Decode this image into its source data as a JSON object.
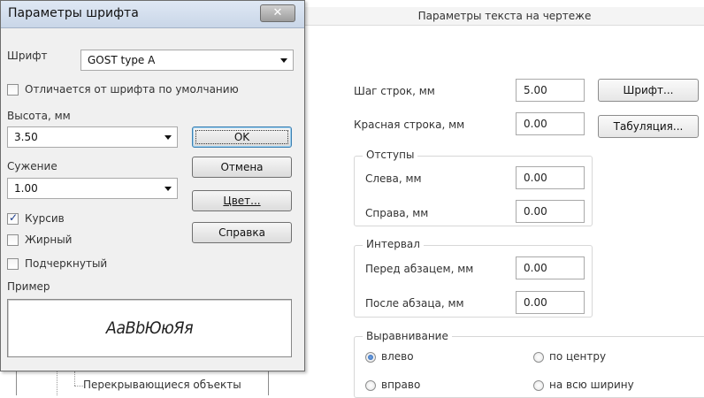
{
  "background_dialog": {
    "title": "Параметры текста на чертеже",
    "line_spacing_label": "Шаг строк, мм",
    "line_spacing_value": "5.00",
    "font_button": "Шрифт...",
    "first_line_label": "Красная строка, мм",
    "first_line_value": "0.00",
    "tab_button": "Табуляция...",
    "indents": {
      "group_label": "Отступы",
      "left_label": "Слева, мм",
      "left_value": "0.00",
      "right_label": "Справа, мм",
      "right_value": "0.00"
    },
    "interval": {
      "group_label": "Интервал",
      "before_label": "Перед абзацем, мм",
      "before_value": "0.00",
      "after_label": "После абзаца, мм",
      "after_value": "0.00"
    },
    "alignment": {
      "group_label": "Выравнивание",
      "left": "влево",
      "center": "по центру",
      "right": "вправо",
      "justify": "на всю ширину",
      "selected": "влево"
    },
    "tree_item": "Перекрывающиеся объекты"
  },
  "font_dialog": {
    "title": "Параметры шрифта",
    "close_symbol": "✕",
    "font_label": "Шрифт",
    "font_value": "GOST type A",
    "differs_checkbox": "Отличается от шрифта по умолчанию",
    "height_label": "Высота, мм",
    "height_value": "3.50",
    "narrowing_label": "Сужение",
    "narrowing_value": "1.00",
    "italic_label": "Курсив",
    "italic_checked": true,
    "bold_label": "Жирный",
    "bold_checked": false,
    "underline_label": "Подчеркнутый",
    "underline_checked": false,
    "sample_label": "Пример",
    "sample_text": "АаBbЮюЯя",
    "buttons": {
      "ok": "OK",
      "cancel": "Отмена",
      "color": "Цвет...",
      "help": "Справка"
    }
  }
}
